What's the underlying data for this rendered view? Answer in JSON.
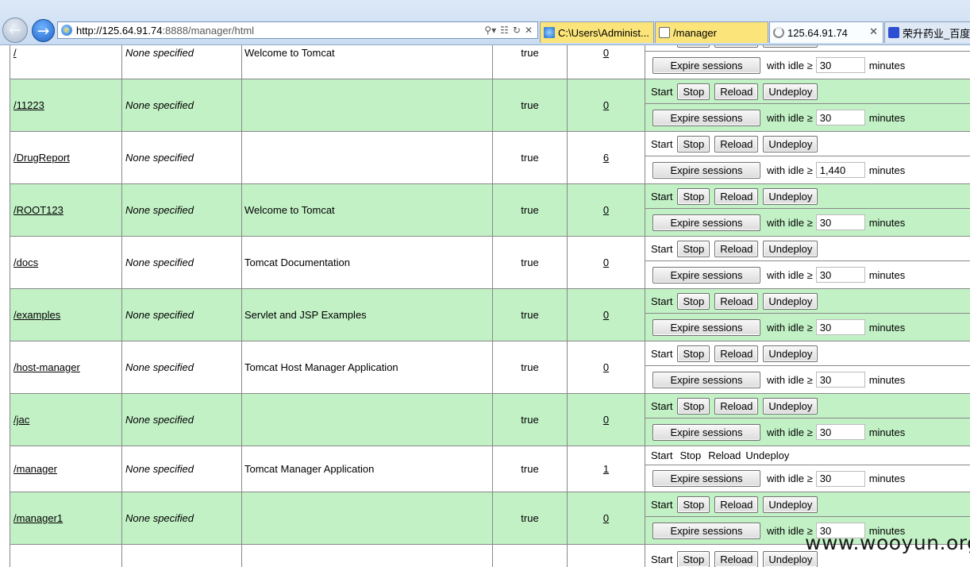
{
  "browser": {
    "address_prefix": "http://125.64.91.74",
    "address_rest": ":8888/manager/html",
    "tabs": [
      {
        "label": "C:\\Users\\Administ...",
        "active": false
      },
      {
        "label": "/manager",
        "active": false
      },
      {
        "label": "125.64.91.74",
        "active": true
      },
      {
        "label": "荣升药业_百度搜",
        "active": false
      }
    ]
  },
  "commands": {
    "start": "Start",
    "stop": "Stop",
    "reload": "Reload",
    "undeploy": "Undeploy",
    "expire": "Expire sessions",
    "with_idle": "with idle ≥",
    "minutes": "minutes"
  },
  "applications": [
    {
      "path": "/",
      "version": "None specified",
      "display_name": "Welcome to Tomcat",
      "running": "true",
      "sessions": "0",
      "idle": "30",
      "links": true
    },
    {
      "path": "/11223",
      "version": "None specified",
      "display_name": "",
      "running": "true",
      "sessions": "0",
      "idle": "30",
      "links": true
    },
    {
      "path": "/DrugReport",
      "version": "None specified",
      "display_name": "",
      "running": "true",
      "sessions": "6",
      "idle": "1,440",
      "links": true
    },
    {
      "path": "/ROOT123",
      "version": "None specified",
      "display_name": "Welcome to Tomcat",
      "running": "true",
      "sessions": "0",
      "idle": "30",
      "links": true
    },
    {
      "path": "/docs",
      "version": "None specified",
      "display_name": "Tomcat Documentation",
      "running": "true",
      "sessions": "0",
      "idle": "30",
      "links": true
    },
    {
      "path": "/examples",
      "version": "None specified",
      "display_name": "Servlet and JSP Examples",
      "running": "true",
      "sessions": "0",
      "idle": "30",
      "links": true
    },
    {
      "path": "/host-manager",
      "version": "None specified",
      "display_name": "Tomcat Host Manager Application",
      "running": "true",
      "sessions": "0",
      "idle": "30",
      "links": true
    },
    {
      "path": "/jac",
      "version": "None specified",
      "display_name": "",
      "running": "true",
      "sessions": "0",
      "idle": "30",
      "links": true
    },
    {
      "path": "/manager",
      "version": "None specified",
      "display_name": "Tomcat Manager Application",
      "running": "true",
      "sessions": "1",
      "idle": "30",
      "links": false
    },
    {
      "path": "/manager1",
      "version": "None specified",
      "display_name": "",
      "running": "true",
      "sessions": "0",
      "idle": "30",
      "links": true
    }
  ],
  "watermark": "www.wooyun.org"
}
